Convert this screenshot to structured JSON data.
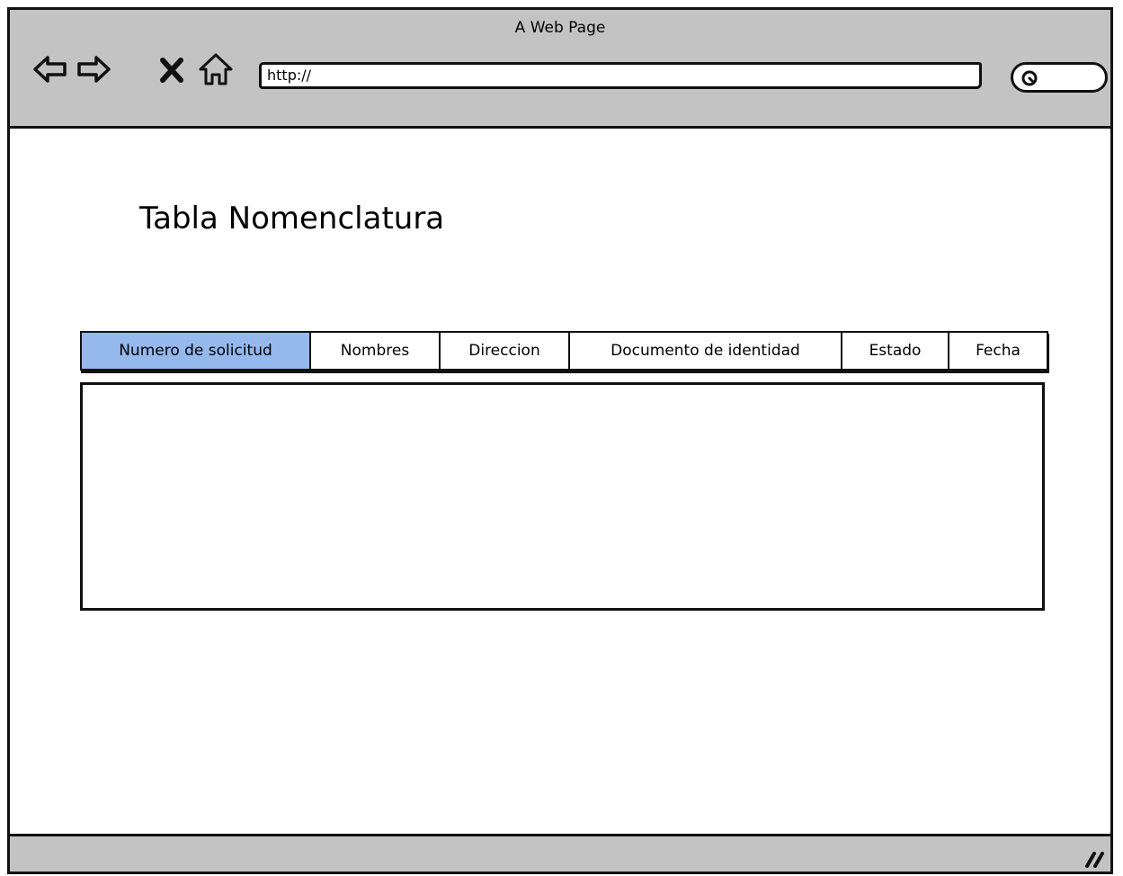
{
  "browser": {
    "window_title": "A Web Page",
    "address_value": "http://",
    "buttons": {
      "back": "arrow-left-icon",
      "forward": "arrow-right-icon",
      "stop": "close-icon",
      "home": "home-icon",
      "search": "search-icon"
    }
  },
  "page": {
    "title": "Tabla Nomenclatura"
  },
  "tabs": [
    {
      "label": "Numero de solicitud",
      "active": true
    },
    {
      "label": "Nombres",
      "active": false
    },
    {
      "label": "Direccion",
      "active": false
    },
    {
      "label": "Documento de identidad",
      "active": false
    },
    {
      "label": "Estado",
      "active": false
    },
    {
      "label": "Fecha",
      "active": false
    }
  ],
  "colors": {
    "chrome": "#c3c3c3",
    "active_tab": "#95b9ec"
  }
}
